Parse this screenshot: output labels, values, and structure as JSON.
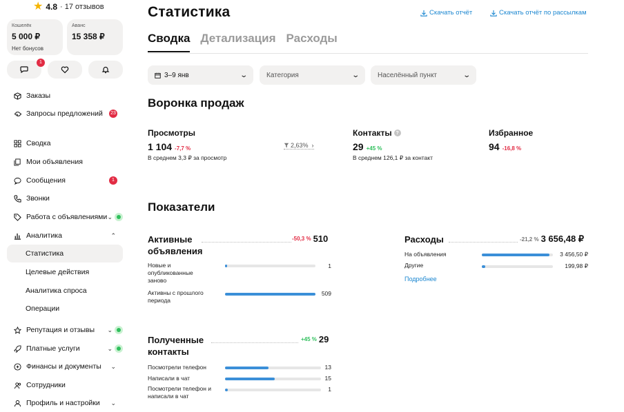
{
  "rating": {
    "score": "4.8",
    "reviews": "· 17 отзывов"
  },
  "wallet": {
    "label": "Кошелёк",
    "amount": "5 000 ₽",
    "note": "Нет бонусов"
  },
  "advance": {
    "label": "Аванс",
    "amount": "15 358 ₽"
  },
  "quick": {
    "messages_badge": "1"
  },
  "nav": {
    "orders": "Заказы",
    "requests": "Запросы предложений",
    "requests_badge": "23",
    "summary": "Сводка",
    "my_ads": "Мои объявления",
    "messages": "Сообщения",
    "messages_badge": "1",
    "calls": "Звонки",
    "ads_work": "Работа с объявлениями",
    "analytics": "Аналитика",
    "statistics": "Статистика",
    "target_actions": "Целевые действия",
    "demand": "Аналитика спроса",
    "operations": "Операции",
    "reputation": "Репутация и отзывы",
    "paid": "Платные услуги",
    "finance": "Финансы и документы",
    "staff": "Сотрудники",
    "profile": "Профиль и настройки"
  },
  "header": {
    "title": "Статистика",
    "download": "Скачать отчёт",
    "download_mail": "Скачать отчёт по рассылкам"
  },
  "tabs": [
    "Сводка",
    "Детализация",
    "Расходы"
  ],
  "filters": {
    "period": "3–9 янв",
    "category": "Категория",
    "city": "Населённый пункт"
  },
  "funnel": {
    "title": "Воронка продаж",
    "views": {
      "label": "Просмотры",
      "value": "1 104",
      "delta": "-7,7 %",
      "note": "В среднем 3,3 ₽ за просмотр"
    },
    "conversion": "2,63%",
    "contacts": {
      "label": "Контакты",
      "value": "29",
      "delta": "+45 %",
      "note": "В среднем 126,1 ₽ за контакт"
    },
    "favorites": {
      "label": "Избранное",
      "value": "94",
      "delta": "-16,8 %"
    }
  },
  "indicators": {
    "title": "Показатели",
    "active": {
      "title": "Активные объявления",
      "delta": "-50,3 %",
      "value": "510",
      "rows": [
        {
          "label": "Новые и опубликованные заново",
          "value": "1",
          "fraction": 0.02
        },
        {
          "label": "Активны с прошлого периода",
          "value": "509",
          "fraction": 1.0
        }
      ]
    },
    "contacts": {
      "title": "Полученные контакты",
      "delta": "+45 %",
      "value": "29",
      "rows": [
        {
          "label": "Посмотрели телефон",
          "value": "13",
          "fraction": 0.45
        },
        {
          "label": "Написали в чат",
          "value": "15",
          "fraction": 0.52
        },
        {
          "label": "Посмотрели телефон и написали в чат",
          "value": "1",
          "fraction": 0.03
        }
      ]
    },
    "expenses": {
      "title": "Расходы",
      "delta": "-21,2 %",
      "value": "3 656,48 ₽",
      "rows": [
        {
          "label": "На объявления",
          "value": "3 456,50 ₽",
          "fraction": 0.95
        },
        {
          "label": "Другие",
          "value": "199,98 ₽",
          "fraction": 0.05
        }
      ],
      "more": "Подробнее"
    }
  },
  "colors": {
    "accent": "#3b8fd8",
    "link": "#1a86d0",
    "negative": "#e22c44",
    "positive": "#2fbf5c"
  }
}
